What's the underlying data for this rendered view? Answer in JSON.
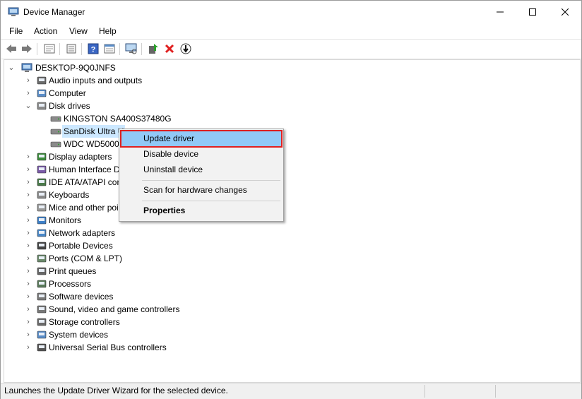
{
  "window": {
    "title": "Device Manager"
  },
  "menu": [
    "File",
    "Action",
    "View",
    "Help"
  ],
  "toolbar": [
    "back-icon",
    "forward-icon",
    "properties-sheet-icon",
    "show-hidden-icon",
    "help-icon",
    "action-view-icon",
    "scan-hardware-icon",
    "update-driver-icon",
    "uninstall-device-icon",
    "disable-device-icon"
  ],
  "tree": {
    "root": "DESKTOP-9Q0JNFS",
    "categories": [
      {
        "label": "Audio inputs and outputs",
        "icon": "speaker-icon"
      },
      {
        "label": "Computer",
        "icon": "computer-icon"
      },
      {
        "label": "Disk drives",
        "icon": "disk-drive-icon",
        "expanded": true,
        "children": [
          "KINGSTON SA400S37480G",
          "SanDisk Ultra USB 3.0 USB Device",
          "WDC WD5000AAKX"
        ]
      },
      {
        "label": "Display adapters",
        "icon": "display-adapter-icon"
      },
      {
        "label": "Human Interface Devices",
        "icon": "hid-icon"
      },
      {
        "label": "IDE ATA/ATAPI controllers",
        "icon": "ide-controller-icon"
      },
      {
        "label": "Keyboards",
        "icon": "keyboard-icon"
      },
      {
        "label": "Mice and other pointing devices",
        "icon": "mouse-icon"
      },
      {
        "label": "Monitors",
        "icon": "monitor-icon"
      },
      {
        "label": "Network adapters",
        "icon": "network-adapter-icon"
      },
      {
        "label": "Portable Devices",
        "icon": "portable-device-icon"
      },
      {
        "label": "Ports (COM & LPT)",
        "icon": "port-icon"
      },
      {
        "label": "Print queues",
        "icon": "printer-icon"
      },
      {
        "label": "Processors",
        "icon": "processor-icon"
      },
      {
        "label": "Software devices",
        "icon": "software-device-icon"
      },
      {
        "label": "Sound, video and game controllers",
        "icon": "sound-controller-icon"
      },
      {
        "label": "Storage controllers",
        "icon": "storage-controller-icon"
      },
      {
        "label": "System devices",
        "icon": "system-device-icon"
      },
      {
        "label": "Universal Serial Bus controllers",
        "icon": "usb-icon"
      }
    ]
  },
  "visible_labels": {
    "hid": "Human Interface De",
    "ide": "IDE ATA/ATAPI cont",
    "mice": "Mice and other poi",
    "sandisk": "SanDisk Ultra U",
    "wdc": "WDC WD5000A"
  },
  "context_menu": {
    "items": [
      "Update driver",
      "Disable device",
      "Uninstall device",
      "Scan for hardware changes",
      "Properties"
    ],
    "highlighted": "Update driver"
  },
  "status": {
    "text": "Launches the Update Driver Wizard for the selected device."
  },
  "colors": {
    "selection": "#cce8ff",
    "menu_highlight": "#91c9f7",
    "highlight_outline": "#e02020"
  }
}
